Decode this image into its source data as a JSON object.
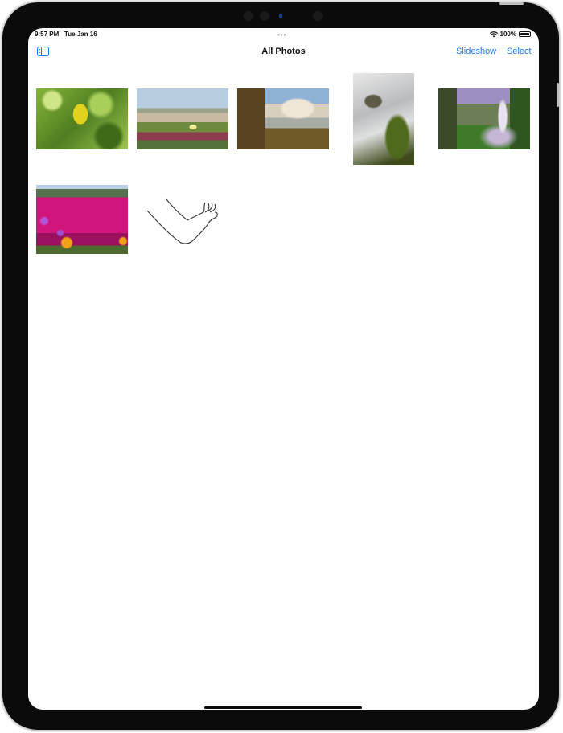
{
  "status_bar": {
    "time": "9:57 PM",
    "date": "Tue Jan 16",
    "battery": "100%",
    "wifi_icon": "wifi-icon",
    "battery_icon": "battery-full-icon"
  },
  "multitasking_indicator": "•••",
  "navbar": {
    "sidebar_icon": "sidebar-toggle-icon",
    "title": "All Photos",
    "slideshow_label": "Slideshow",
    "select_label": "Select"
  },
  "photos": [
    {
      "name": "green-leaves-yellow-leaf",
      "orientation": "landscape"
    },
    {
      "name": "dune-ice-plants",
      "orientation": "landscape"
    },
    {
      "name": "waterfall-cliff",
      "orientation": "landscape"
    },
    {
      "name": "waterfall-closeup-moss",
      "orientation": "portrait"
    },
    {
      "name": "waterfall-valley-purple-sky",
      "orientation": "landscape"
    },
    {
      "name": "magenta-flower-field",
      "orientation": "landscape"
    },
    {
      "name": "arm-waving-sketch",
      "orientation": "drawing"
    }
  ],
  "colors": {
    "accent": "#1a7cf5",
    "bezel": "#0b0b0b",
    "background": "#ffffff"
  }
}
